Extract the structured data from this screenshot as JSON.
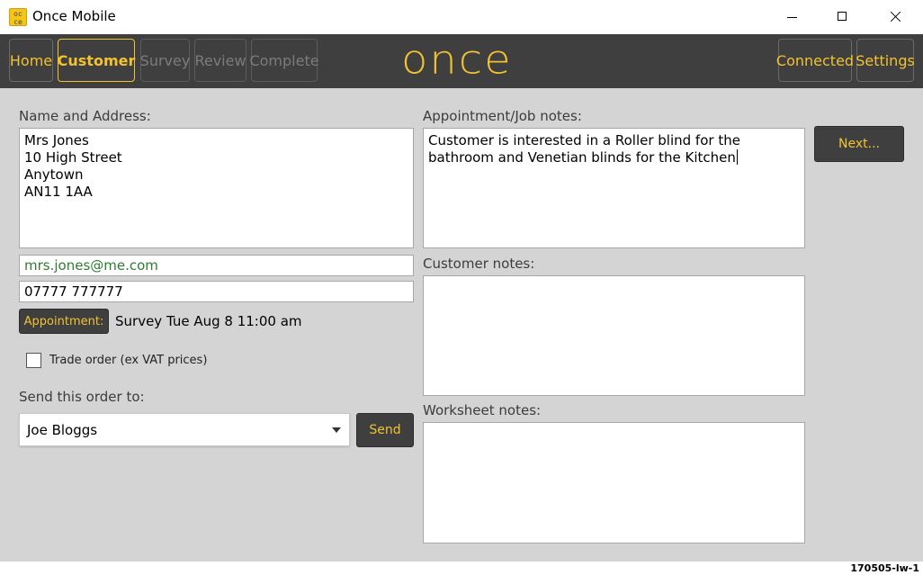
{
  "window": {
    "title": "Once Mobile",
    "icon_name": "once-app-icon"
  },
  "nav": {
    "logo": "once",
    "buttons": [
      {
        "label": "Home",
        "state": "enabled"
      },
      {
        "label": "Customer",
        "state": "active"
      },
      {
        "label": "Survey",
        "state": "disabled"
      },
      {
        "label": "Review",
        "state": "disabled"
      },
      {
        "label": "Complete",
        "state": "disabled"
      }
    ],
    "right_buttons": [
      {
        "label": "Connected"
      },
      {
        "label": "Settings"
      }
    ]
  },
  "customer": {
    "name_address_label": "Name and Address:",
    "name_address": "Mrs Jones\n10 High Street\nAnytown\nAN11 1AA",
    "email": "mrs.jones@me.com",
    "phone": "07777 777777",
    "appointment_button": "Appointment:",
    "appointment_text": "Survey Tue Aug 8 11:00 am",
    "trade_order_label": "Trade order (ex VAT prices)",
    "trade_order_checked": false,
    "send_label": "Send this order to:",
    "send_to_selected": "Joe Bloggs",
    "send_button": "Send"
  },
  "notes": {
    "job_notes_label": "Appointment/Job notes:",
    "job_notes": "Customer is interested in a Roller blind for the bathroom and Venetian blinds for the Kitchen",
    "customer_notes_label": "Customer notes:",
    "customer_notes": "",
    "worksheet_notes_label": "Worksheet notes:",
    "worksheet_notes": "",
    "next_button": "Next..."
  },
  "status": {
    "version": "170505-lw-1"
  },
  "colors": {
    "accent": "#f2c230",
    "nav_background": "#3f3f3f",
    "panel_background": "#d4d4d4",
    "email_text": "#2e7d32"
  }
}
